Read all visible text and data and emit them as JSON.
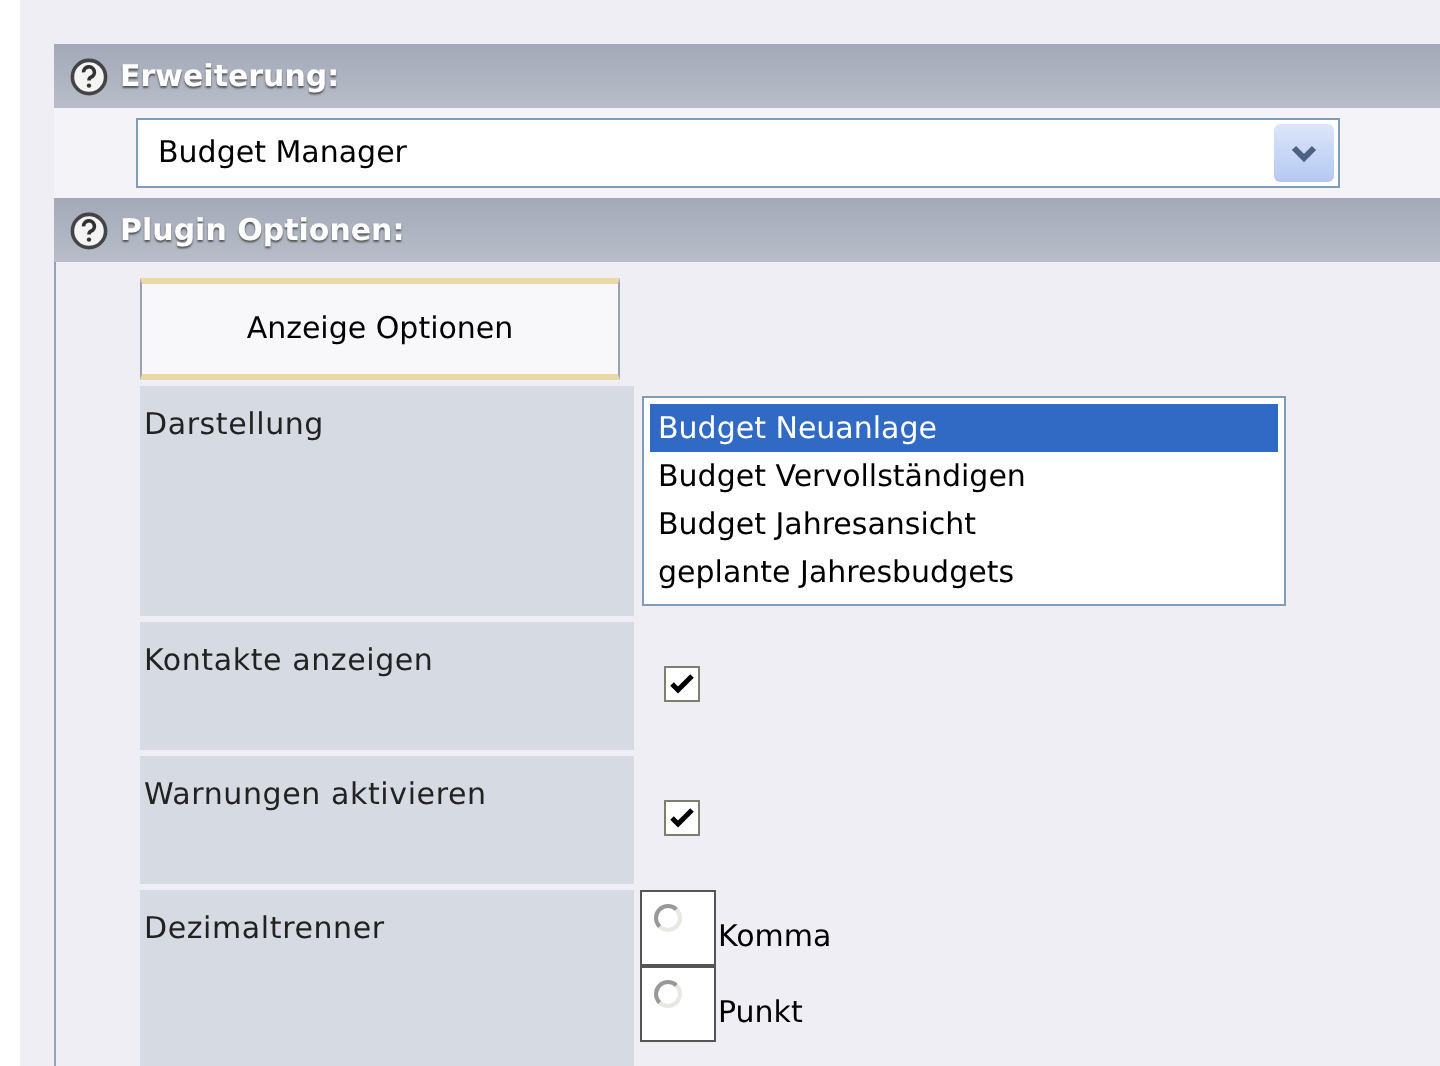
{
  "sections": [
    {
      "title": "Erweiterung:"
    },
    {
      "title": "Plugin Optionen:"
    }
  ],
  "extension_select": {
    "value": "Budget Manager"
  },
  "tabs": [
    {
      "label": "Anzeige Optionen",
      "selected": true
    }
  ],
  "options": [
    {
      "kind": "listbox",
      "label": "Darstellung",
      "items": [
        {
          "label": "Budget Neuanlage",
          "selected": true
        },
        {
          "label": "Budget Vervollständigen",
          "selected": false
        },
        {
          "label": "Budget Jahresansicht",
          "selected": false
        },
        {
          "label": "geplante Jahresbudgets",
          "selected": false
        }
      ]
    },
    {
      "kind": "checkbox",
      "label": "Kontakte anzeigen",
      "checked": true
    },
    {
      "kind": "checkbox",
      "label": "Warnungen aktivieren",
      "checked": true
    },
    {
      "kind": "radio",
      "label": "Dezimaltrenner",
      "items": [
        {
          "label": "Komma",
          "selected": false
        },
        {
          "label": "Punkt",
          "selected": false
        }
      ]
    }
  ]
}
